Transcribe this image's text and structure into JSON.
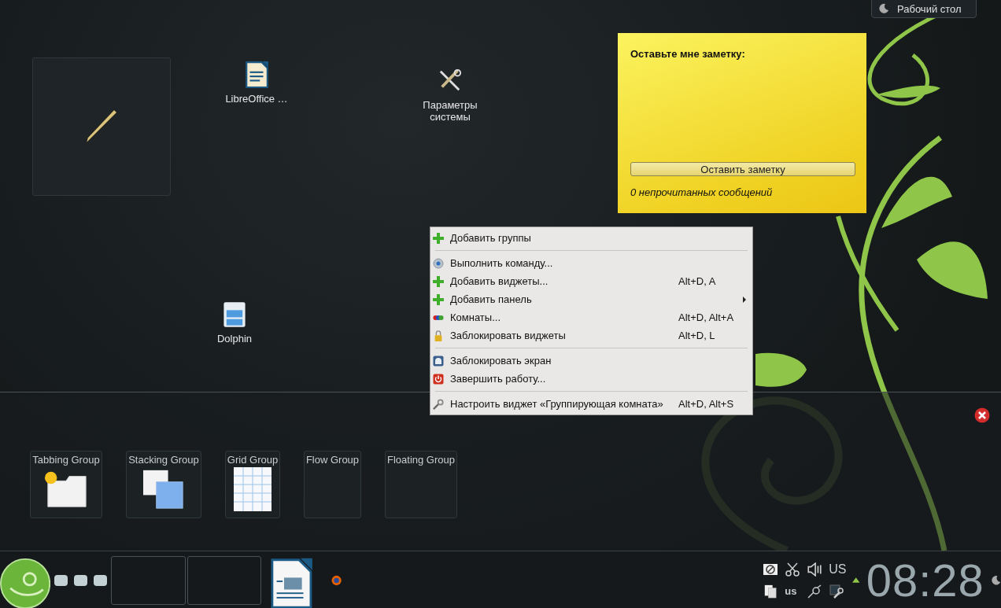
{
  "activity_button": {
    "label": "Рабочий стол"
  },
  "desktop_icons": [
    {
      "kind": "document",
      "label": "LibreOffice …"
    },
    {
      "kind": "tools",
      "label": "Параметры системы"
    },
    {
      "kind": "cabinet",
      "label": "Dolphin"
    }
  ],
  "note_widget": {
    "title": "Оставьте мне заметку:",
    "button": "Оставить заметку",
    "status": "0 непрочитанных сообщений"
  },
  "context_menu": [
    {
      "kind": "plus",
      "label": "Добавить группы",
      "has_submenu": false
    },
    {
      "kind": "separator"
    },
    {
      "kind": "gear",
      "label": "Выполнить команду...",
      "has_submenu": false
    },
    {
      "kind": "plus",
      "label": "Добавить виджеты...",
      "shortcut": "Alt+D, A",
      "has_submenu": false
    },
    {
      "kind": "plus",
      "label": "Добавить панель",
      "has_submenu": true
    },
    {
      "kind": "rooms",
      "label": "Комнаты...",
      "shortcut": "Alt+D, Alt+A",
      "has_submenu": false
    },
    {
      "kind": "lock",
      "label": "Заблокировать виджеты",
      "shortcut": "Alt+D, L",
      "has_submenu": false
    },
    {
      "kind": "separator"
    },
    {
      "kind": "screen",
      "label": "Заблокировать экран",
      "has_submenu": false
    },
    {
      "kind": "power",
      "label": "Завершить работу...",
      "has_submenu": false
    },
    {
      "kind": "separator"
    },
    {
      "kind": "wrench",
      "label": "Настроить виджет «Группирующая комната»",
      "shortcut": "Alt+D, Alt+S",
      "has_submenu": false
    }
  ],
  "groups": [
    {
      "kind": "tabbing",
      "label": "Tabbing Group"
    },
    {
      "kind": "stacking",
      "label": "Stacking Group"
    },
    {
      "kind": "grid",
      "label": "Grid Group"
    },
    {
      "kind": "flow",
      "label": "Flow Group"
    },
    {
      "kind": "floating",
      "label": "Floating Group"
    }
  ],
  "tray": {
    "layout_top": "US",
    "layout_bottom": "us"
  },
  "clock": "08:28"
}
